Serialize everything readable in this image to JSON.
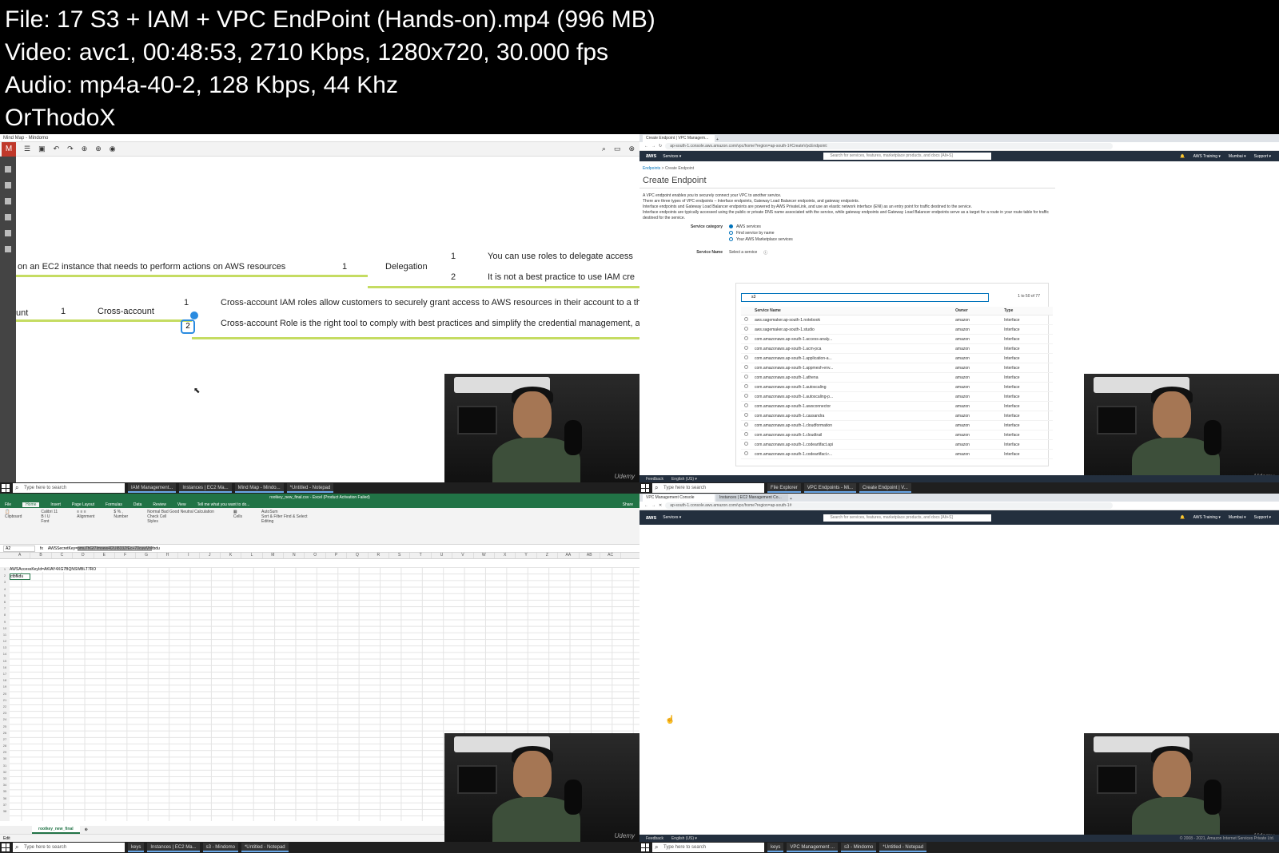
{
  "header": {
    "file": "File: 17  S3 + IAM + VPC EndPoint (Hands-on).mp4 (996 MB)",
    "video": "Video: avc1, 00:48:53, 2710 Kbps, 1280x720, 30.000 fps",
    "audio": "Audio: mp4a-40-2, 128 Kbps, 44 Khz",
    "tag": "OrThodoX"
  },
  "webcam_watermark": "Udemy",
  "mindmap": {
    "window_title": "Mind Map - Mindomo",
    "n1": "on an EC2 instance that needs to perform actions on AWS resources",
    "n1_num": "1",
    "delegation": "Delegation",
    "d1_num": "1",
    "d1": "You can use roles to delegate access",
    "d2_num": "2",
    "d2": "It is not a best practice to use IAM cre",
    "n2": "unt",
    "n2_num": "1",
    "cross": "Cross-account",
    "c1_num": "1",
    "c1": "Cross-account IAM roles allow customers to securely grant access to AWS resources in their account to a th",
    "c2_num": "2",
    "c2": "Cross-account Role is the right tool to comply with best practices and simplify the credential management, a"
  },
  "browser1": {
    "tab": "Create Endpoint | VPC Managem...",
    "url": "ap-south-1.console.aws.amazon.com/vpc/home?region=ap-south-1#CreateVpcEndpoint:",
    "aws_logo": "aws",
    "services": "Services ▾",
    "search_placeholder": "Search for services, features, marketplace products, and docs   [Alt+S]",
    "right1": "AWS Training ▾",
    "right2": "Mumbai ▾",
    "right3": "Support ▾",
    "crumb_link": "Endpoints",
    "crumb_rest": " > Create Endpoint",
    "title": "Create Endpoint",
    "desc1": "A VPC endpoint enables you to securely connect your VPC to another service.",
    "desc2": "There are three types of VPC endpoints – Interface endpoints, Gateway Load Balancer endpoints, and gateway endpoints.",
    "desc3": "Interface endpoints and Gateway Load Balancer endpoints are powered by AWS PrivateLink, and use an elastic network interface (ENI) as an entry point for traffic destined to the service.",
    "desc4": "Interface endpoints are typically accessed using the public or private DNS name associated with the service, while gateway endpoints and Gateway Load Balancer endpoints serve as a target for a route in your route table for traffic destined for the service.",
    "svc_cat_label": "Service category",
    "opt1": "AWS services",
    "opt2": "Find service by name",
    "opt3": "Your AWS Marketplace services",
    "svc_name_label": "Service Name",
    "svc_name_value": "Select a service",
    "filter_value": "s3",
    "paging": "1 to 50 of 77",
    "col_name": "Service Name",
    "col_owner": "Owner",
    "col_type": "Type",
    "rows": [
      [
        "aws.sagemaker.ap-south-1.notebook",
        "amazon",
        "Interface"
      ],
      [
        "aws.sagemaker.ap-south-1.studio",
        "amazon",
        "Interface"
      ],
      [
        "com.amazonaws.ap-south-1.access-analy...",
        "amazon",
        "Interface"
      ],
      [
        "com.amazonaws.ap-south-1.acm-pca",
        "amazon",
        "Interface"
      ],
      [
        "com.amazonaws.ap-south-1.application-a...",
        "amazon",
        "Interface"
      ],
      [
        "com.amazonaws.ap-south-1.appmesh-env...",
        "amazon",
        "Interface"
      ],
      [
        "com.amazonaws.ap-south-1.athena",
        "amazon",
        "Interface"
      ],
      [
        "com.amazonaws.ap-south-1.autoscaling",
        "amazon",
        "Interface"
      ],
      [
        "com.amazonaws.ap-south-1.autoscaling-p...",
        "amazon",
        "Interface"
      ],
      [
        "com.amazonaws.ap-south-1.awsconnector",
        "amazon",
        "Interface"
      ],
      [
        "com.amazonaws.ap-south-1.cassandra",
        "amazon",
        "Interface"
      ],
      [
        "com.amazonaws.ap-south-1.cloudformation",
        "amazon",
        "Interface"
      ],
      [
        "com.amazonaws.ap-south-1.cloudtrail",
        "amazon",
        "Interface"
      ],
      [
        "com.amazonaws.ap-south-1.codeartifact.api",
        "amazon",
        "Interface"
      ],
      [
        "com.amazonaws.ap-south-1.codeartifact.r...",
        "amazon",
        "Interface"
      ]
    ],
    "feedback": "Feedback",
    "lang": "English (US) ▾"
  },
  "taskbar1": {
    "search": "Type here to search",
    "items": [
      "IAM Management...",
      "Instances | EC2 Ma...",
      "Mind Map - Mindo...",
      "*Untitled - Notepad"
    ]
  },
  "taskbar2": {
    "search": "Type here to search",
    "items": [
      "File Explorer",
      "VPC Endpoints - Mi...",
      "Create Endpoint | V..."
    ]
  },
  "excel": {
    "title": "rootkey_new_final.csv - Excel (Product Activation Failed)",
    "menu": [
      "File",
      "Home",
      "Insert",
      "Page Layout",
      "Formulas",
      "Data",
      "Review",
      "View",
      "Tell me what you want to do..."
    ],
    "share": "Share",
    "cell_ref": "A2",
    "fx_prefix": "AWSSecretKey=",
    "fx_selected": "pmu7hGf7Imoew4l2UI833ZfEc+70cuwVnl",
    "fx_suffix": "tbdu",
    "a1": "AWSAccessKeyId=AKIAY4XG7BQNSWBLT7RO",
    "a2": "ctbfkdu",
    "sheet": "rootkey_new_final",
    "status": "Edit",
    "cols": [
      "A",
      "B",
      "C",
      "D",
      "E",
      "F",
      "G",
      "H",
      "I",
      "J",
      "K",
      "L",
      "M",
      "N",
      "O",
      "P",
      "Q",
      "R",
      "S",
      "T",
      "U",
      "V",
      "W",
      "X",
      "Y",
      "Z",
      "AA",
      "AB",
      "AC"
    ],
    "ribbon_groups": [
      "Clipboard",
      "Font",
      "Alignment",
      "Number",
      "Styles",
      "Cells",
      "Editing"
    ],
    "font_name": "Calibri",
    "font_size": "11",
    "style_normal": "Normal",
    "style_bad": "Bad",
    "style_good": "Good",
    "style_neutral": "Neutral",
    "style_calc": "Calculation",
    "style_check": "Check Cell",
    "autosum": "AutoSum",
    "sort": "Sort & Filter",
    "find": "Find & Select"
  },
  "taskbar3": {
    "search": "Type here to search",
    "items": [
      "keys",
      "Instances | EC2 Ma...",
      "s3 - Mindomo",
      "*Untitled - Notepad"
    ]
  },
  "browser2": {
    "tab1": "VPC Management Console",
    "tab2": "Instances | EC2 Management Co...",
    "url": "ap-south-1.console.aws.amazon.com/vpc/home?region=ap-south-1#",
    "services": "Services ▾",
    "search_placeholder": "Search for services, features, marketplace products, and docs   [Alt+S]",
    "right1": "AWS Training ▾",
    "right2": "Mumbai ▾",
    "right3": "Support ▾",
    "feedback": "Feedback",
    "lang": "English (US) ▾",
    "copyright": "© 2008 - 2021, Amazon Internet Services Private Ltd."
  },
  "taskbar4": {
    "search": "Type here to search",
    "items": [
      "keys",
      "VPC Management ...",
      "s3 - Mindomo",
      "*Untitled - Notepad"
    ]
  }
}
